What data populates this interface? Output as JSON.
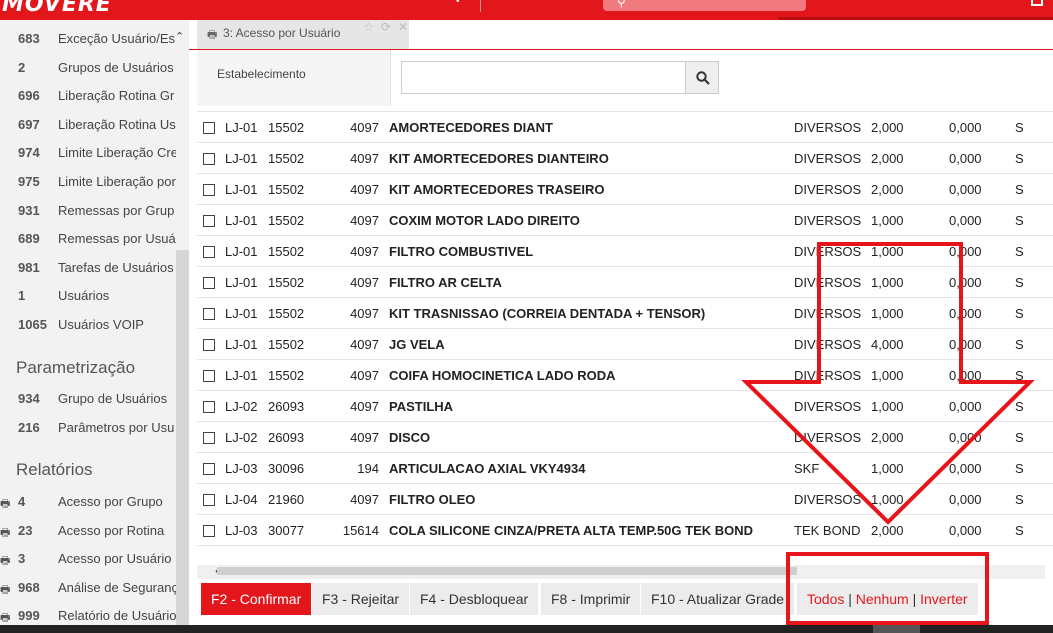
{
  "app": {
    "logo": "MOVERE"
  },
  "sidebar": {
    "items_top": [
      {
        "num": "683",
        "label": "Exceção Usuário/Es"
      },
      {
        "num": "2",
        "label": "Grupos de Usuários"
      },
      {
        "num": "696",
        "label": "Liberação Rotina Gr"
      },
      {
        "num": "697",
        "label": "Liberação Rotina Us"
      },
      {
        "num": "974",
        "label": "Limite Liberação Cre"
      },
      {
        "num": "975",
        "label": "Limite Liberação por"
      },
      {
        "num": "931",
        "label": "Remessas por Grup"
      },
      {
        "num": "689",
        "label": "Remessas por Usuá"
      },
      {
        "num": "981",
        "label": "Tarefas de Usuários"
      },
      {
        "num": "1",
        "label": "Usuários"
      },
      {
        "num": "1065",
        "label": "Usuários VOIP"
      }
    ],
    "section_param": "Parametrização",
    "items_param": [
      {
        "num": "934",
        "label": "Grupo de Usuários"
      },
      {
        "num": "216",
        "label": "Parâmetros por Usu"
      }
    ],
    "section_reports": "Relatórios",
    "items_reports": [
      {
        "num": "4",
        "label": "Acesso por Grupo"
      },
      {
        "num": "23",
        "label": "Acesso por Rotina"
      },
      {
        "num": "3",
        "label": "Acesso por Usuário"
      },
      {
        "num": "968",
        "label": "Análise de Seguranç"
      },
      {
        "num": "999",
        "label": "Relatório de Usuário"
      }
    ]
  },
  "tab": {
    "label": "3: Acesso por Usuário"
  },
  "filter": {
    "label": "Estabelecimento",
    "value": ""
  },
  "grid": {
    "rows": [
      {
        "loja": "LJ-01",
        "code": "15502",
        "num": "4097",
        "desc": "AMORTECEDORES DIANT",
        "grp": "DIVERSOS",
        "q1": "2,000",
        "q2": "0,000",
        "s": "S"
      },
      {
        "loja": "LJ-01",
        "code": "15502",
        "num": "4097",
        "desc": "KIT AMORTECEDORES DIANTEIRO",
        "grp": "DIVERSOS",
        "q1": "2,000",
        "q2": "0,000",
        "s": "S"
      },
      {
        "loja": "LJ-01",
        "code": "15502",
        "num": "4097",
        "desc": "KIT AMORTECEDORES TRASEIRO",
        "grp": "DIVERSOS",
        "q1": "2,000",
        "q2": "0,000",
        "s": "S"
      },
      {
        "loja": "LJ-01",
        "code": "15502",
        "num": "4097",
        "desc": "COXIM MOTOR LADO DIREITO",
        "grp": "DIVERSOS",
        "q1": "1,000",
        "q2": "0,000",
        "s": "S"
      },
      {
        "loja": "LJ-01",
        "code": "15502",
        "num": "4097",
        "desc": "FILTRO COMBUSTIVEL",
        "grp": "DIVERSOS",
        "q1": "1,000",
        "q2": "0,000",
        "s": "S"
      },
      {
        "loja": "LJ-01",
        "code": "15502",
        "num": "4097",
        "desc": "FILTRO AR CELTA",
        "grp": "DIVERSOS",
        "q1": "1,000",
        "q2": "0,000",
        "s": "S"
      },
      {
        "loja": "LJ-01",
        "code": "15502",
        "num": "4097",
        "desc": "KIT TRASNISSAO (CORREIA DENTADA + TENSOR)",
        "grp": "DIVERSOS",
        "q1": "1,000",
        "q2": "0,000",
        "s": "S"
      },
      {
        "loja": "LJ-01",
        "code": "15502",
        "num": "4097",
        "desc": "JG VELA",
        "grp": "DIVERSOS",
        "q1": "4,000",
        "q2": "0,000",
        "s": "S"
      },
      {
        "loja": "LJ-01",
        "code": "15502",
        "num": "4097",
        "desc": "COIFA HOMOCINETICA LADO RODA",
        "grp": "DIVERSOS",
        "q1": "1,000",
        "q2": "0,000",
        "s": "S"
      },
      {
        "loja": "LJ-02",
        "code": "26093",
        "num": "4097",
        "desc": "PASTILHA",
        "grp": "DIVERSOS",
        "q1": "1,000",
        "q2": "0,000",
        "s": "S"
      },
      {
        "loja": "LJ-02",
        "code": "26093",
        "num": "4097",
        "desc": "DISCO",
        "grp": "DIVERSOS",
        "q1": "2,000",
        "q2": "0,000",
        "s": "S"
      },
      {
        "loja": "LJ-03",
        "code": "30096",
        "num": "194",
        "desc": "ARTICULACAO AXIAL VKY4934",
        "grp": "SKF",
        "q1": "1,000",
        "q2": "0,000",
        "s": "S"
      },
      {
        "loja": "LJ-04",
        "code": "21960",
        "num": "4097",
        "desc": "FILTRO OLEO",
        "grp": "DIVERSOS",
        "q1": "1,000",
        "q2": "0,000",
        "s": "S"
      },
      {
        "loja": "LJ-03",
        "code": "30077",
        "num": "15614",
        "desc": "COLA SILICONE CINZA/PRETA ALTA TEMP.50G TEK BOND",
        "grp": "TEK BOND",
        "q1": "2,000",
        "q2": "0,000",
        "s": "S"
      }
    ]
  },
  "footer": {
    "confirm": "F2 - Confirmar",
    "reject": "F3 - Rejeitar",
    "unlock": "F4 - Desbloquear",
    "print": "F8 - Imprimir",
    "refresh": "F10 - Atualizar Grade",
    "all": "Todos",
    "none": "Nenhum",
    "invert": "Inverter",
    "sep": "|"
  },
  "colors": {
    "brand": "#e3161b",
    "annotation": "#e8141c"
  }
}
